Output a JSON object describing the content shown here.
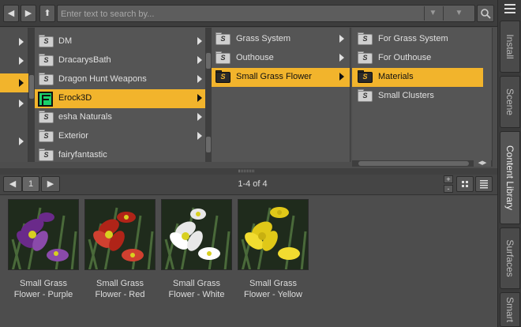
{
  "search": {
    "placeholder": "Enter text to search by..."
  },
  "toolbar": {
    "back": "◀",
    "forward": "▶",
    "up": "⬆",
    "search_icon": "search-icon"
  },
  "columns": {
    "col2": [
      {
        "label": "DM"
      },
      {
        "label": "DracarysBath"
      },
      {
        "label": "Dragon Hunt Weapons"
      },
      {
        "label": "Erock3D"
      },
      {
        "label": "esha Naturals"
      },
      {
        "label": "Exterior"
      },
      {
        "label": "fairyfantastic"
      }
    ],
    "col3": [
      {
        "label": "Grass System"
      },
      {
        "label": "Outhouse"
      },
      {
        "label": "Small Grass Flower"
      }
    ],
    "col4": [
      {
        "label": "For Grass System"
      },
      {
        "label": "For Outhouse"
      },
      {
        "label": "Materials"
      },
      {
        "label": "Small Clusters"
      }
    ]
  },
  "pager": {
    "page": "1",
    "count": "1-4 of 4"
  },
  "assets": [
    {
      "line1": "Small Grass",
      "line2": "Flower - Purple",
      "petal": "#6a2a8a",
      "petal2": "#8a4aaa"
    },
    {
      "line1": "Small Grass",
      "line2": "Flower - Red",
      "petal": "#b02418",
      "petal2": "#d04030"
    },
    {
      "line1": "Small Grass",
      "line2": "Flower - White",
      "petal": "#e8e8e8",
      "petal2": "#ffffff"
    },
    {
      "line1": "Small Grass",
      "line2": "Flower - Yellow",
      "petal": "#e0c818",
      "petal2": "#f2dc30"
    }
  ],
  "sidebar": {
    "tabs": [
      "Install",
      "Scene",
      "Content Library",
      "Surfaces",
      "Smart"
    ]
  },
  "colors": {
    "accent": "#f2b42c"
  }
}
